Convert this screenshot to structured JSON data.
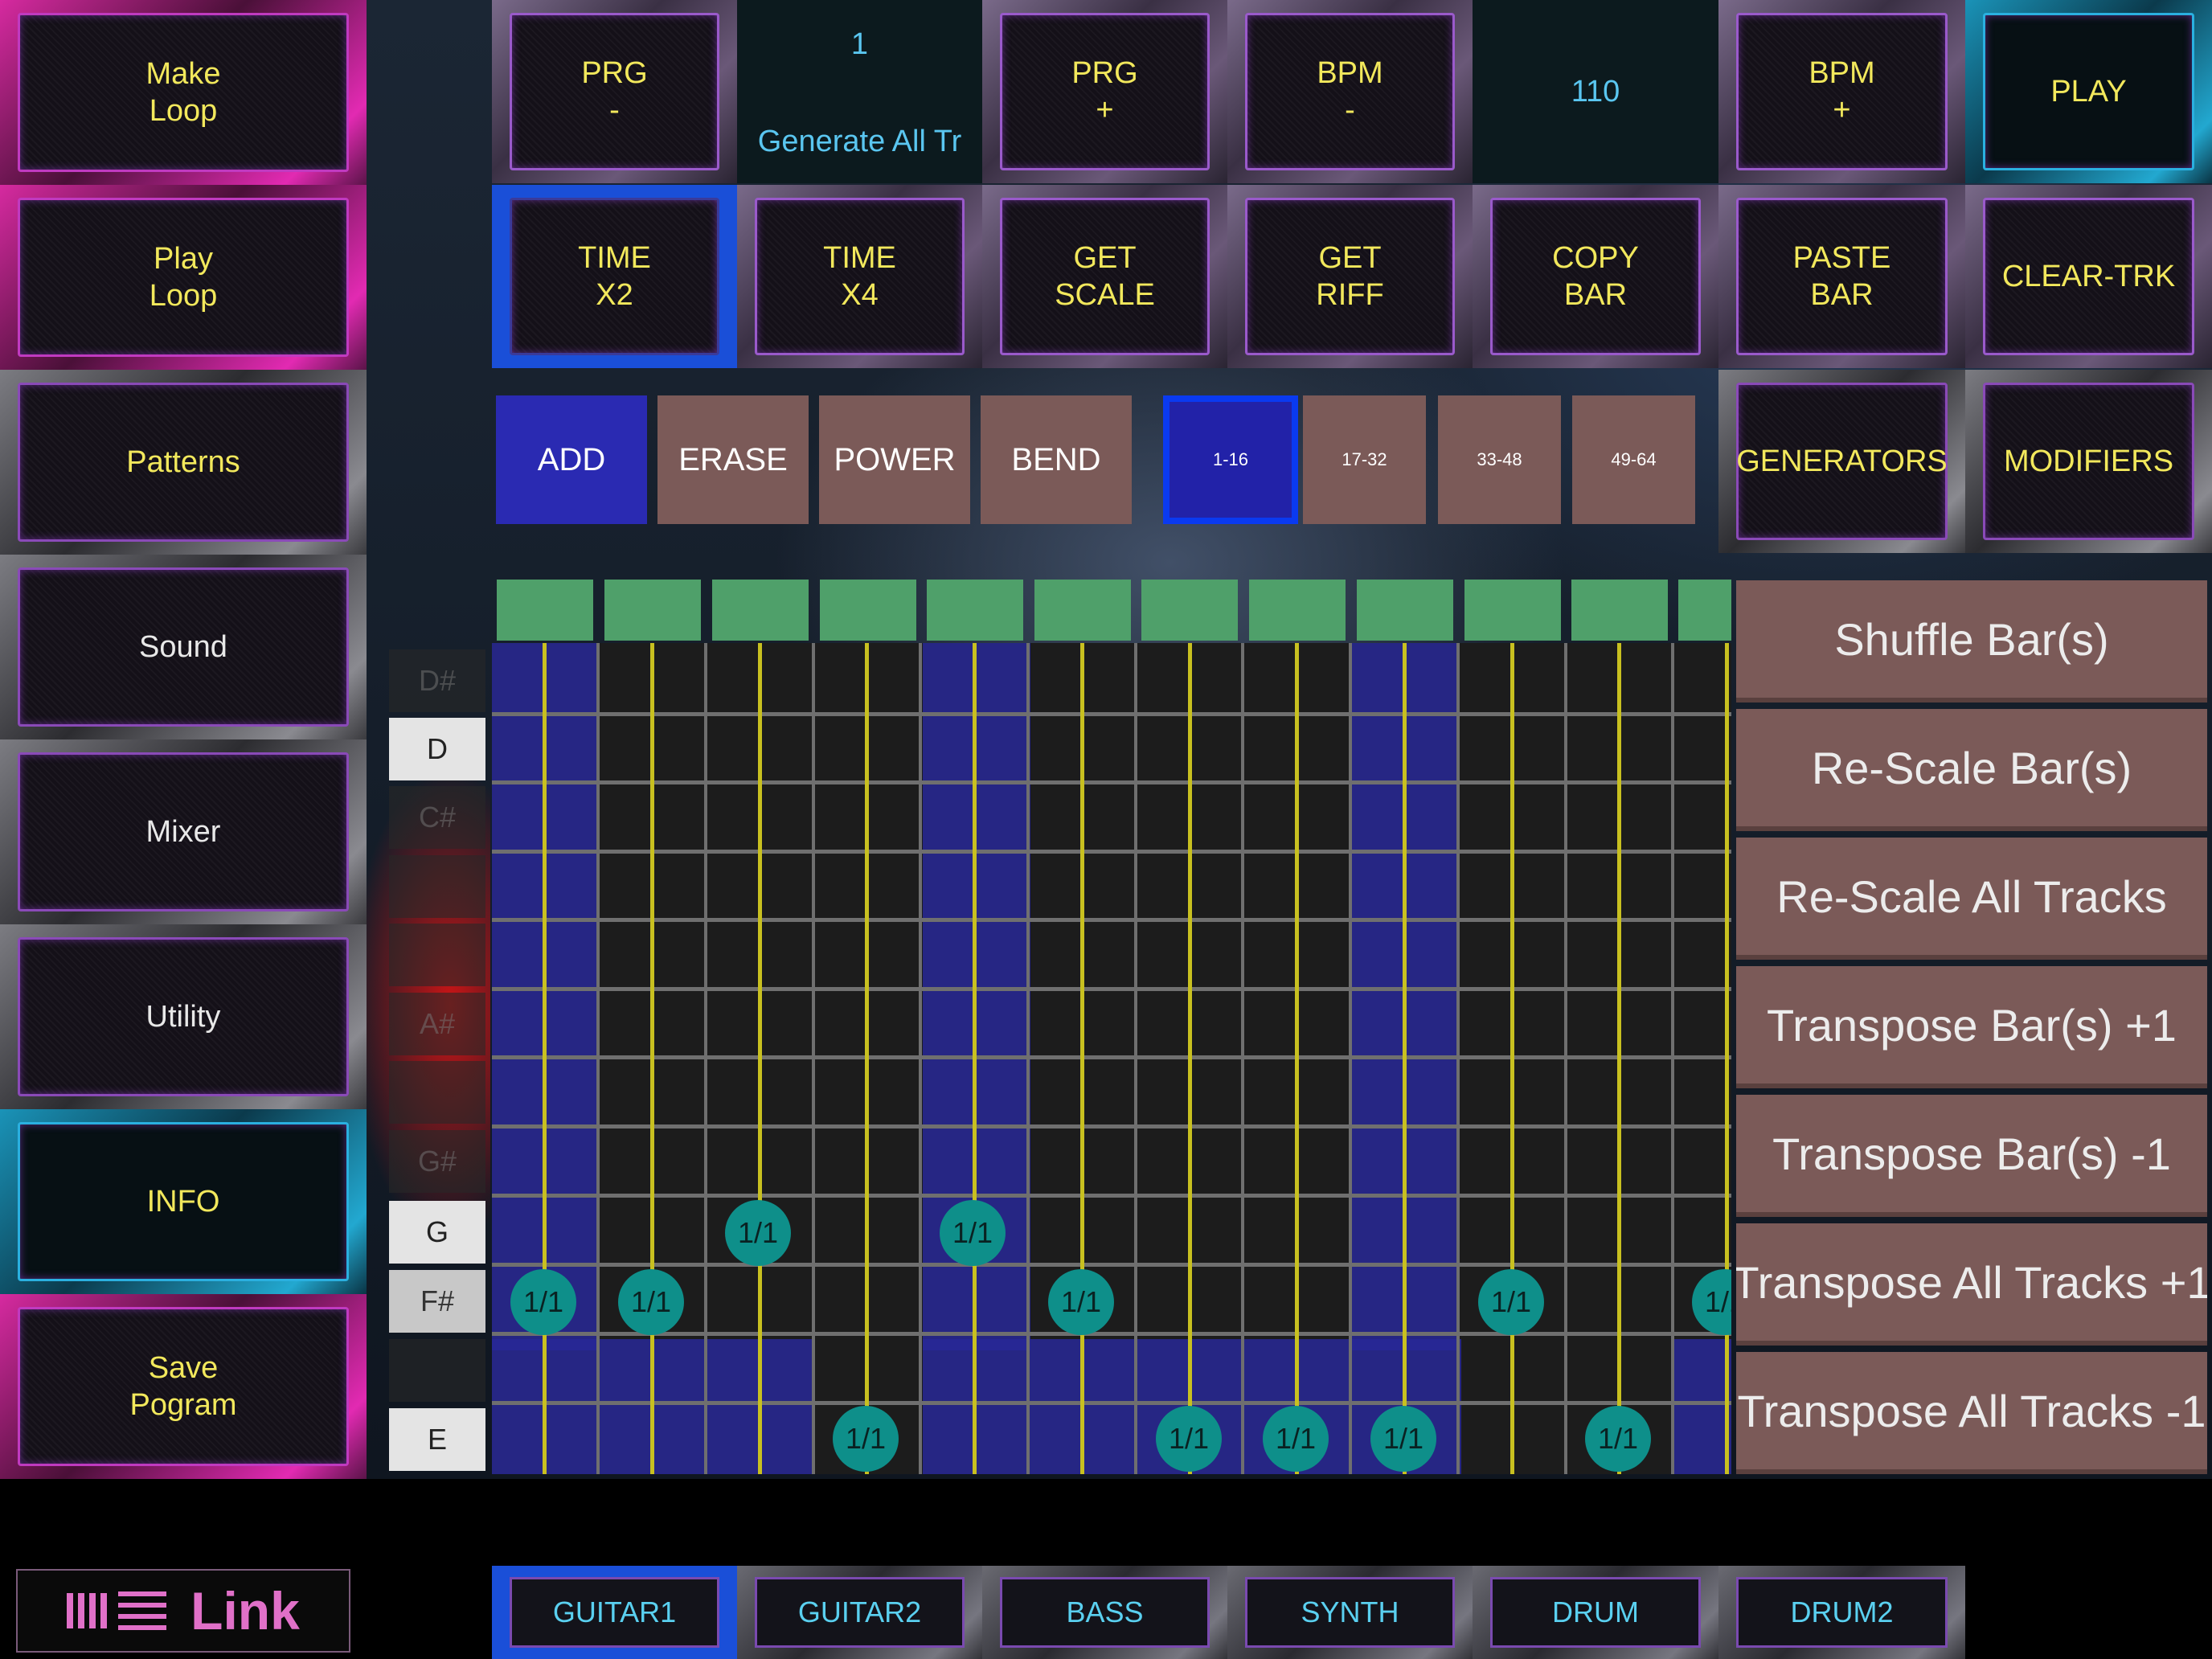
{
  "sidebar": {
    "make_loop": "Make\nLoop",
    "play_loop": "Play\nLoop",
    "patterns": "Patterns",
    "sound": "Sound",
    "mixer": "Mixer",
    "utility": "Utility",
    "info": "INFO",
    "save_program": "Save\nPogram"
  },
  "top_row": {
    "prg_minus": "PRG\n-",
    "program_number": "1",
    "program_name": "Generate All Tr",
    "prg_plus": "PRG\n+",
    "bpm_minus": "BPM\n-",
    "bpm_value": "110",
    "bpm_plus": "BPM\n+",
    "play": "PLAY"
  },
  "second_row": {
    "time_x2": "TIME\nX2",
    "time_x4": "TIME\nX4",
    "get_scale": "GET\nSCALE",
    "get_riff": "GET\nRIFF",
    "copy_bar": "COPY\nBAR",
    "paste_bar": "PASTE\nBAR",
    "clear_trk": "CLEAR-TRK"
  },
  "edit_modes": {
    "add": "ADD",
    "erase": "ERASE",
    "power": "POWER",
    "bend": "BEND",
    "active": "ADD"
  },
  "step_ranges": {
    "r1": "1-16",
    "r2": "17-32",
    "r3": "33-48",
    "r4": "49-64",
    "active": "1-16"
  },
  "panels": {
    "generators": "GENERATORS",
    "modifiers": "MODIFIERS"
  },
  "note_labels": {
    "ds": "D#",
    "d": "D",
    "cs": "C#",
    "as": "A#",
    "gs": "G#",
    "g": "G",
    "fs": "F#",
    "e": "E"
  },
  "note_value": "1/1",
  "modifier_list": {
    "m1": "Shuffle Bar(s)",
    "m2": "Re-Scale Bar(s)",
    "m3": "Re-Scale All Tracks",
    "m4": "Transpose Bar(s) +1",
    "m5": "Transpose Bar(s) -1",
    "m6": "Transpose All Tracks +1",
    "m7": "Transpose All Tracks -1"
  },
  "tracks": {
    "t1": "GUITAR1",
    "t2": "GUITAR2",
    "t3": "BASS",
    "t4": "SYNTH",
    "t5": "DRUM",
    "t6": "DRUM2",
    "selected": "GUITAR1"
  },
  "link_label": "Link",
  "colors": {
    "button_text": "#f2e85c",
    "info_text": "#5ac6f0",
    "note_circle": "#0e8f8a",
    "selection_blue": "#1a4fd8",
    "modifier_bg": "#7b5a58",
    "step_header": "#4fa06a"
  }
}
